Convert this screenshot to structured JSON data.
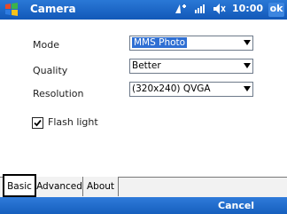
{
  "titlebar": {
    "title": "Camera",
    "time": "10:00",
    "ok_label": "ok"
  },
  "form": {
    "mode": {
      "label": "Mode",
      "value": "MMS Photo"
    },
    "quality": {
      "label": "Quality",
      "value": "Better"
    },
    "resolution": {
      "label": "Resolution",
      "value": "(320x240) QVGA"
    },
    "flash": {
      "label": "Flash light",
      "checked": true
    }
  },
  "tabs": [
    {
      "label": "Basic",
      "active": true
    },
    {
      "label": "Advanced",
      "active": false
    },
    {
      "label": "About",
      "active": false
    }
  ],
  "softkeys": {
    "right": "Cancel"
  },
  "colors": {
    "titlebar": "#1e6acb",
    "selection": "#2f6fd3"
  },
  "icons": [
    "windows-start-icon",
    "connectivity-icon",
    "signal-icon",
    "speaker-icon",
    "chevron-down-icon",
    "checkmark-icon"
  ]
}
